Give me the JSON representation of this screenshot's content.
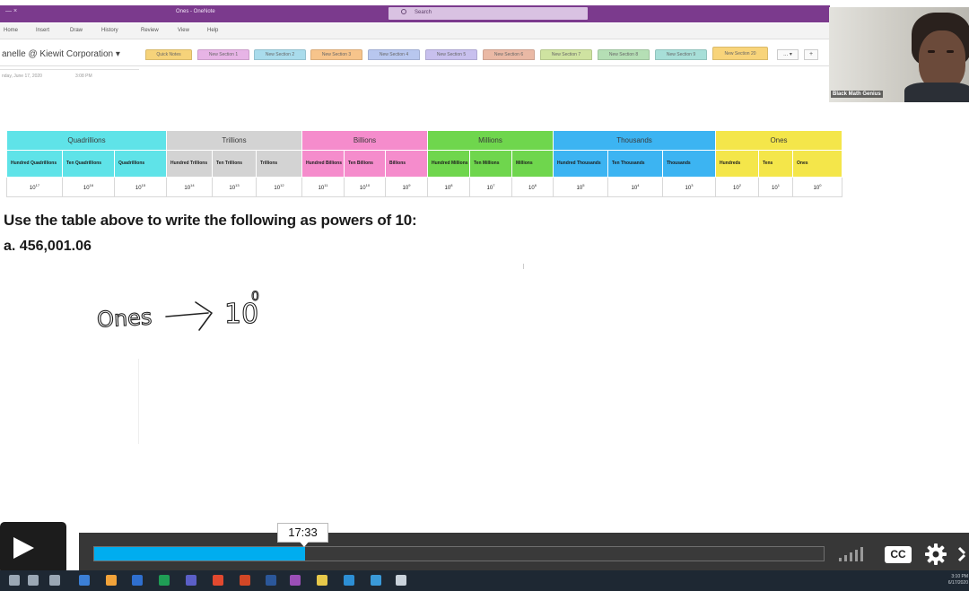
{
  "onenote": {
    "window_title": "Ones - OneNote",
    "window_controls": "—  ×",
    "search_placeholder": "Search",
    "menu": [
      "Home",
      "Insert",
      "Draw",
      "History",
      "Review",
      "View",
      "Help"
    ],
    "notebook": "anelle @ Kiewit Corporation ▾",
    "sections": [
      {
        "label": "Quick Notes",
        "color": "#f6d37a"
      },
      {
        "label": "New Section 1",
        "color": "#e7b4e6"
      },
      {
        "label": "New Section 2",
        "color": "#a9dcec"
      },
      {
        "label": "New Section 3",
        "color": "#f7c48b"
      },
      {
        "label": "New Section 4",
        "color": "#b8c7ef"
      },
      {
        "label": "New Section 5",
        "color": "#c8c0ee"
      },
      {
        "label": "New Section 6",
        "color": "#eab9a5"
      },
      {
        "label": "New Section 7",
        "color": "#cfe3a1"
      },
      {
        "label": "New Section 8",
        "color": "#b5dfb5"
      },
      {
        "label": "New Section 9",
        "color": "#a7dfd8"
      },
      {
        "label": "New Section 20",
        "color": "#f8d47a"
      }
    ],
    "more_tabs": "... ▾",
    "add_tab": "+",
    "page_date": "nday, June 17, 2020",
    "page_time": "3:08 PM"
  },
  "webcam": {
    "label": "Black Math Genius"
  },
  "table": {
    "groups": [
      {
        "name": "Quadrillions",
        "color": "#5fe3e8",
        "span": 3
      },
      {
        "name": "Trillions",
        "color": "#d3d3d3",
        "span": 3
      },
      {
        "name": "Billions",
        "color": "#f58ccc",
        "span": 3
      },
      {
        "name": "Millions",
        "color": "#6fd64d",
        "span": 3
      },
      {
        "name": "Thousands",
        "color": "#3cb4f2",
        "span": 3
      },
      {
        "name": "Ones",
        "color": "#f4e64a",
        "span": 3
      }
    ],
    "places": [
      "Hundred Quadrillions",
      "Ten Quadrillions",
      "Quadrillions",
      "Hundred Trillions",
      "Ten Trillions",
      "Trillions",
      "Hundred Billions",
      "Ten Billions",
      "Billions",
      "Hundred Millions",
      "Ten Millions",
      "Millions",
      "Hundred Thousands",
      "Ten Thousands",
      "Thousands",
      "Hundreds",
      "Tens",
      "Ones"
    ],
    "exponents": [
      "17",
      "16",
      "15",
      "14",
      "13",
      "12",
      "11",
      "10",
      "9",
      "8",
      "7",
      "6",
      "5",
      "4",
      "3",
      "2",
      "1",
      "0"
    ],
    "base": "10"
  },
  "question": "Use the table above to write the following as powers of 10:",
  "item_a": "a.  456,001.06",
  "handwriting": {
    "word": "Ones",
    "result": "10",
    "exponent": "0"
  },
  "player": {
    "timestamp": "17:33",
    "progress": 0.289,
    "cc_label": "CC"
  },
  "taskbar": {
    "clock_time": "3:10 PM",
    "clock_date": "6/17/2020"
  }
}
